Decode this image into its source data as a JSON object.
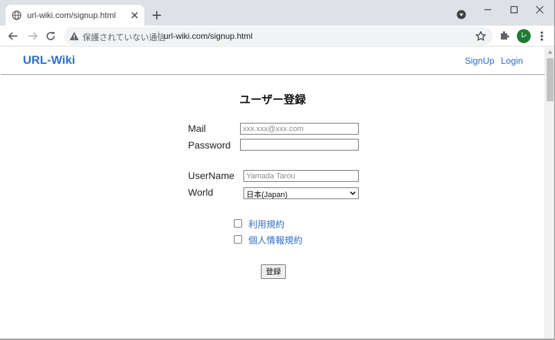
{
  "browser": {
    "tab": {
      "title": "url-wiki.com/signup.html",
      "icon": "globe-icon"
    },
    "address_bar": {
      "security_text": "保護されていない通信",
      "url": "url-wiki.com/signup.html"
    },
    "profile_initial": "レ"
  },
  "site": {
    "logo": "URL-Wiki",
    "nav": {
      "signup": "SignUp",
      "login": "Login"
    }
  },
  "form": {
    "title": "ユーザー登録",
    "mail": {
      "label": "Mail",
      "placeholder": "xxx.xxx@xxx.com",
      "value": ""
    },
    "password": {
      "label": "Password",
      "value": ""
    },
    "username": {
      "label": "UserName",
      "placeholder": "Yamada Tarou",
      "value": ""
    },
    "world": {
      "label": "World",
      "selected": "日本(Japan)"
    },
    "terms": {
      "label": "利用規約",
      "checked": false
    },
    "privacy": {
      "label": "個人情報規約",
      "checked": false
    },
    "submit": "登録"
  },
  "colors": {
    "link": "#2f6ecb",
    "titlebar": "#dee1e6",
    "avatar": "#1e7a34"
  }
}
